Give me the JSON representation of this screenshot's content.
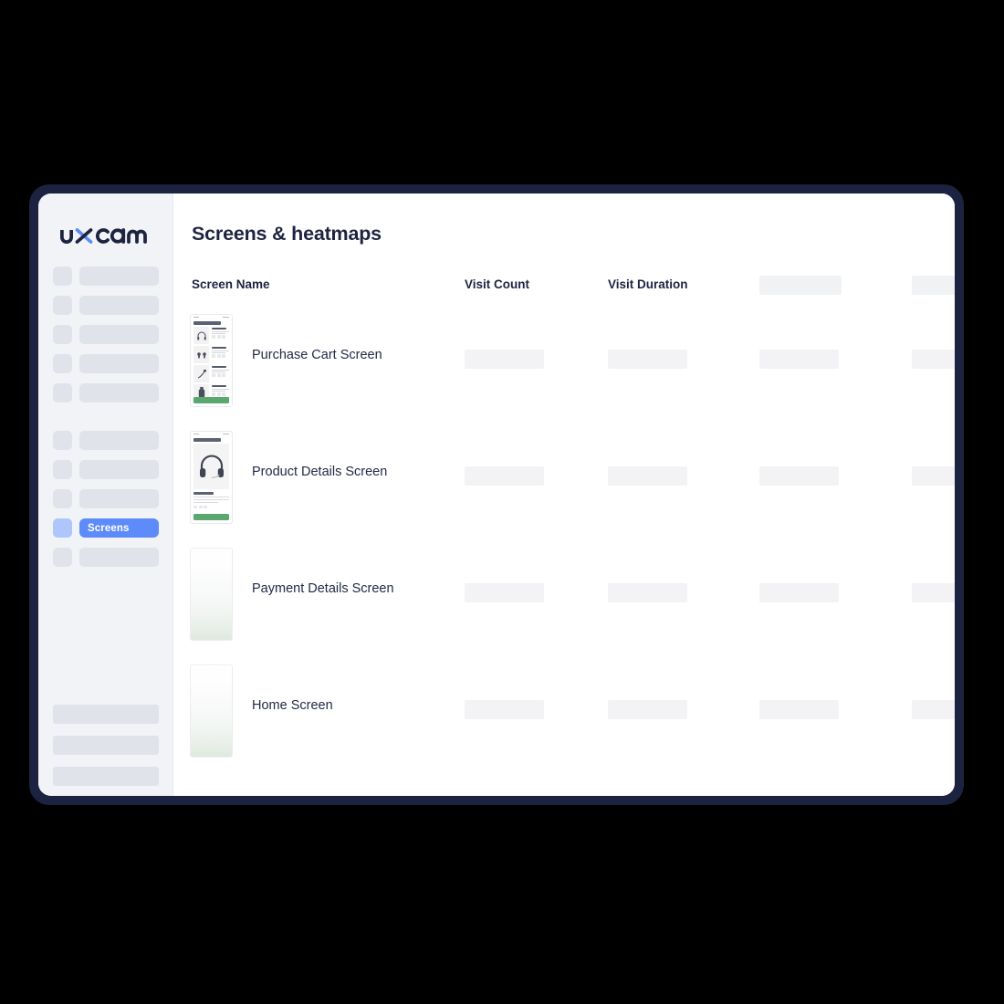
{
  "brand": {
    "logo_text": "uxcam",
    "logo_accent_color": "#5d8cfa",
    "logo_color": "#1e2440"
  },
  "sidebar": {
    "active_item_label": "Screens",
    "active_item_bg": "#5d8cfa",
    "background": "#f1f3f6",
    "group_1_placeholder_count": 5,
    "group_2_placeholder_count": 5,
    "group_3_placeholder_count": 3
  },
  "header": {
    "title": "Screens & heatmaps"
  },
  "table": {
    "columns": [
      {
        "key": "screen_name",
        "label": "Screen Name",
        "type": "text"
      },
      {
        "key": "visit_count",
        "label": "Visit Count",
        "type": "text"
      },
      {
        "key": "visit_duration",
        "label": "Visit Duration",
        "type": "text"
      },
      {
        "key": "column_4",
        "label": "",
        "type": "skeleton"
      },
      {
        "key": "column_5",
        "label": "",
        "type": "skeleton"
      }
    ],
    "rows": [
      {
        "screen_name": "Purchase Cart Screen",
        "thumbnail": "purchase-cart-screen-thumbnail",
        "visit_count": "",
        "visit_duration": ""
      },
      {
        "screen_name": "Product Details Screen",
        "thumbnail": "product-details-screen-thumbnail",
        "visit_count": "",
        "visit_duration": ""
      },
      {
        "screen_name": "Payment Details Screen",
        "thumbnail": "payment-details-screen-thumbnail",
        "visit_count": "",
        "visit_duration": ""
      },
      {
        "screen_name": "Home Screen",
        "thumbnail": "home-screen-thumbnail",
        "visit_count": "",
        "visit_duration": ""
      }
    ]
  },
  "theme": {
    "frame_color": "#1b2340",
    "page_background": "#000000",
    "content_background": "#ffffff",
    "skeleton_color": "#e1e3ea",
    "cell_skeleton_color": "#f3f3f5",
    "text_color": "#1e2440",
    "accent_green": "#5aa86f"
  }
}
